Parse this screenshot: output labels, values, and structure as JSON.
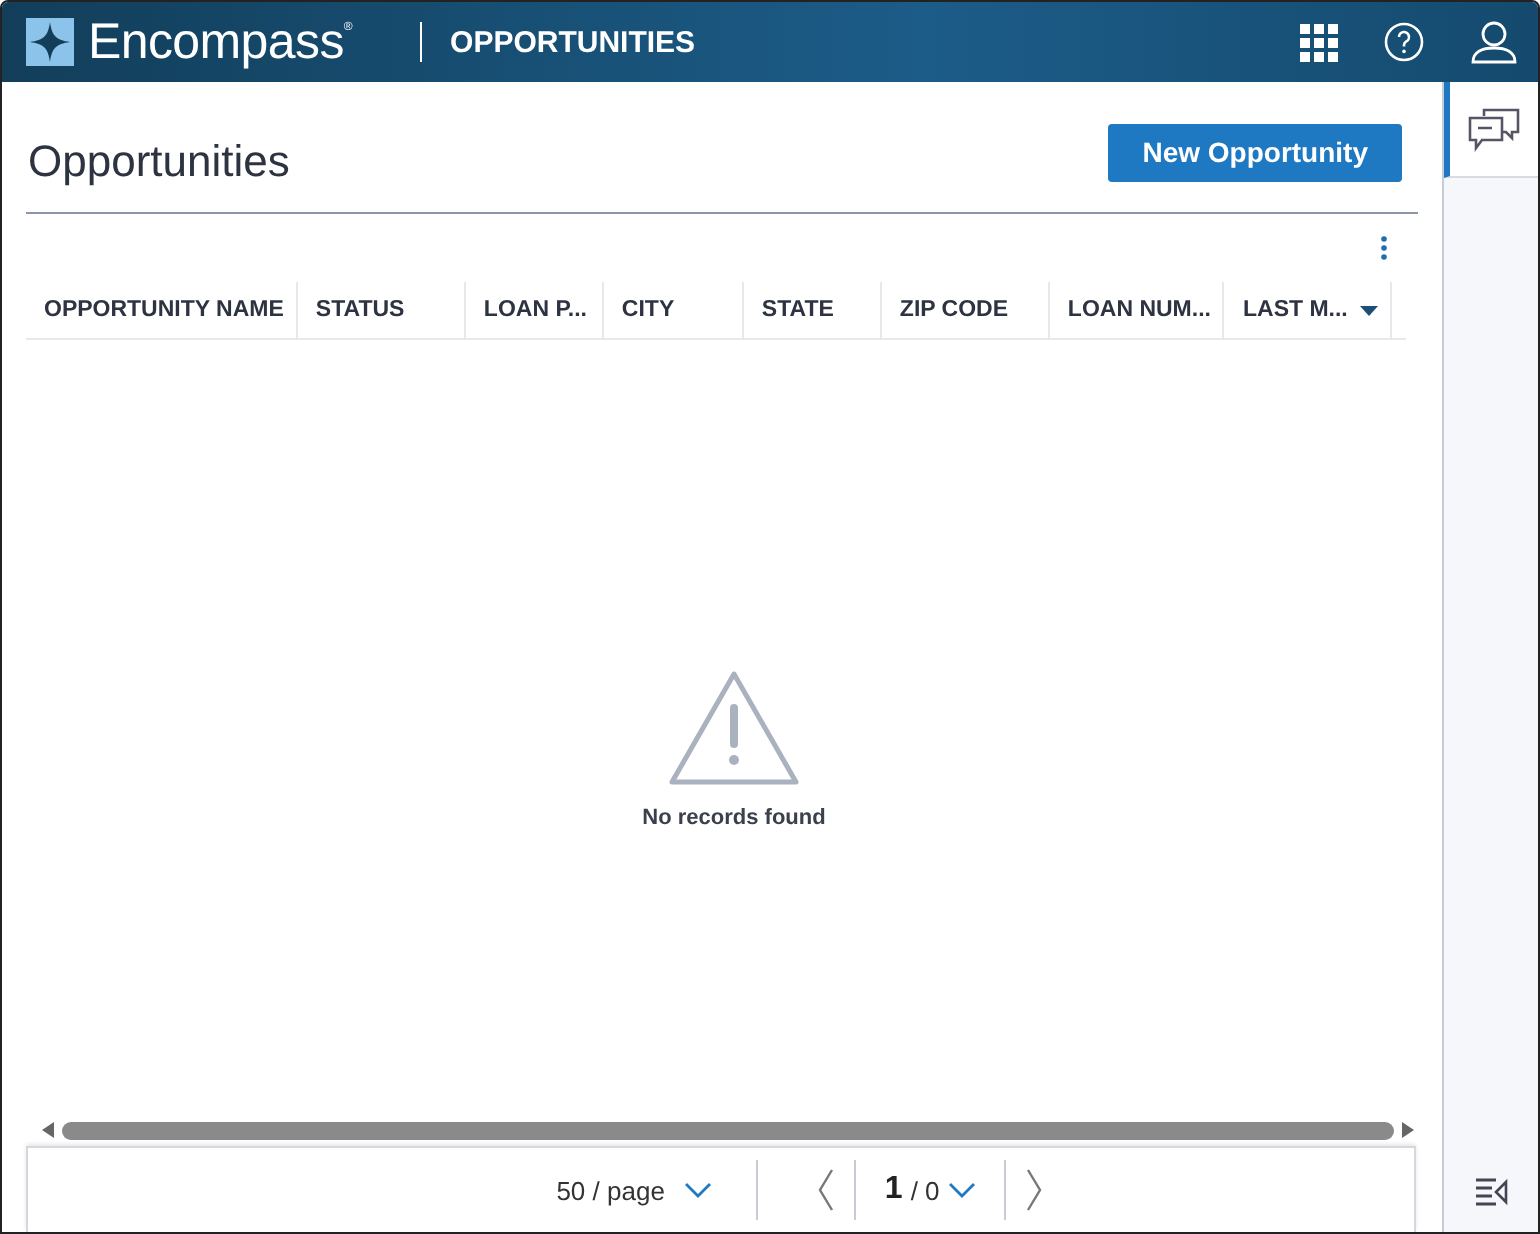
{
  "header": {
    "brand": "Encompass",
    "brand_mark": "®",
    "section": "OPPORTUNITIES"
  },
  "page": {
    "title": "Opportunities",
    "new_button": "New Opportunity"
  },
  "table": {
    "columns": [
      {
        "label": "OPPORTUNITY NAME",
        "sorted": false
      },
      {
        "label": "STATUS",
        "sorted": false
      },
      {
        "label": "LOAN P...",
        "sorted": false
      },
      {
        "label": "CITY",
        "sorted": false
      },
      {
        "label": "STATE",
        "sorted": false
      },
      {
        "label": "ZIP CODE",
        "sorted": false
      },
      {
        "label": "LOAN NUM...",
        "sorted": false
      },
      {
        "label": "LAST M...",
        "sorted": true
      }
    ],
    "empty_message": "No records found"
  },
  "pagination": {
    "page_size": "50 / page",
    "current_page": "1",
    "total_pages": "/ 0"
  }
}
